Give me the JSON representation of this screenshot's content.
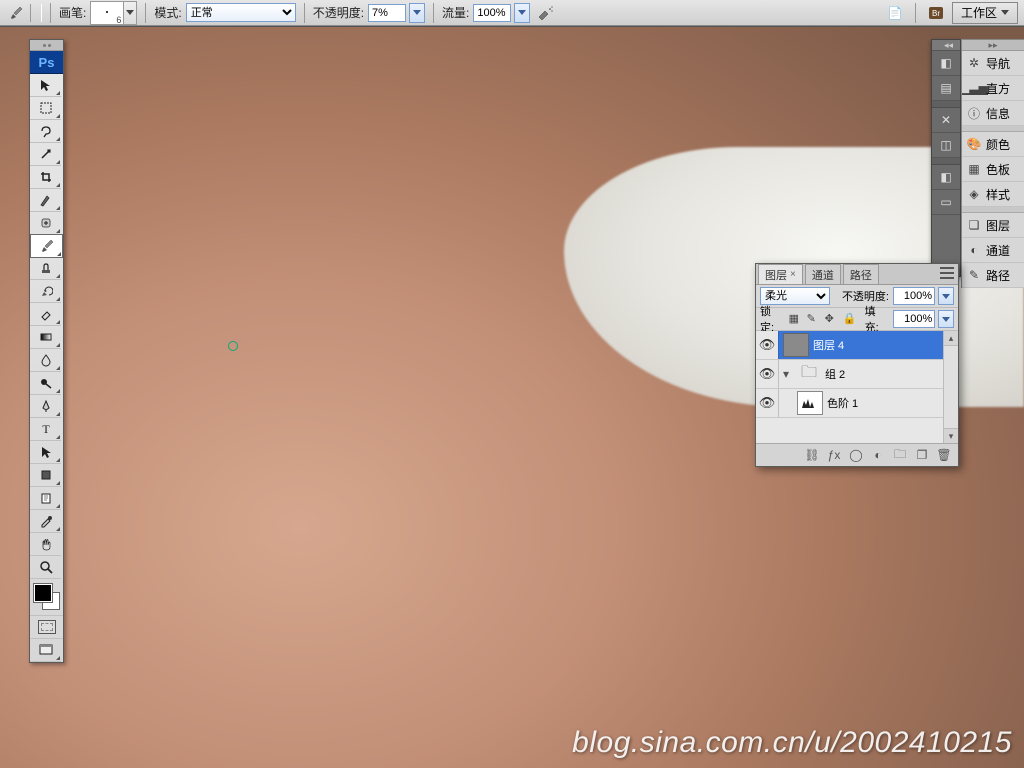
{
  "optbar": {
    "brush_label": "画笔:",
    "brush_size": "6",
    "mode_label": "模式:",
    "mode_value": "正常",
    "opacity_label": "不透明度:",
    "opacity_value": "7%",
    "flow_label": "流量:",
    "flow_value": "100%",
    "workspace_label": "工作区"
  },
  "right_col": {
    "items": [
      {
        "icon": "compass",
        "label": "导航"
      },
      {
        "icon": "histogram",
        "label": "直方"
      },
      {
        "icon": "info",
        "label": "信息"
      },
      {
        "icon": "palette",
        "label": "颜色"
      },
      {
        "icon": "swatches",
        "label": "色板"
      },
      {
        "icon": "styles",
        "label": "样式"
      },
      {
        "icon": "layers",
        "label": "图层"
      },
      {
        "icon": "channels",
        "label": "通道"
      },
      {
        "icon": "paths",
        "label": "路径"
      }
    ]
  },
  "layers_panel": {
    "tabs": {
      "layers": "图层",
      "channels": "通道",
      "paths": "路径"
    },
    "blend_value": "柔光",
    "opacity_label": "不透明度:",
    "opacity_value": "100%",
    "lock_label": "锁定:",
    "fill_label": "填充:",
    "fill_value": "100%",
    "items": [
      {
        "name": "图层 4",
        "type": "layer",
        "selected": true
      },
      {
        "name": "组 2",
        "type": "group",
        "selected": false
      },
      {
        "name": "色阶 1",
        "type": "adjust",
        "selected": false
      }
    ]
  },
  "watermark": "blog.sina.com.cn/u/2002410215"
}
